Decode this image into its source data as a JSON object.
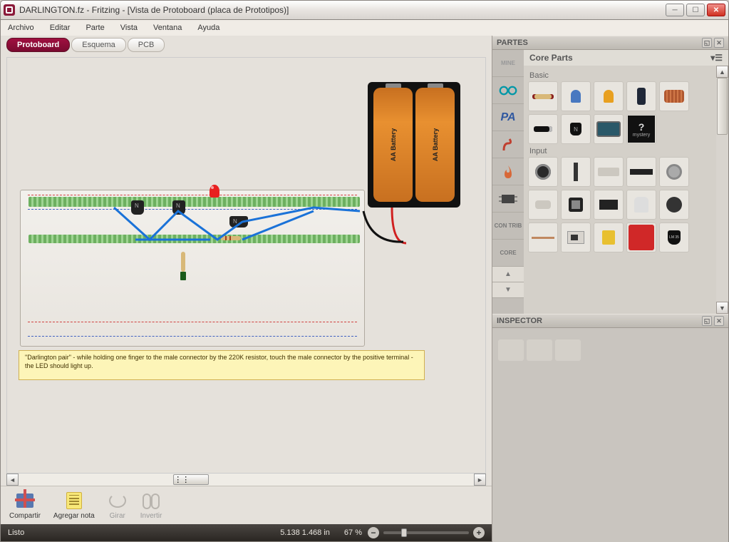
{
  "title": "DARLINGTON.fz - Fritzing - [Vista de Protoboard (placa de Prototipos)]",
  "menu": {
    "archivo": "Archivo",
    "editar": "Editar",
    "parte": "Parte",
    "vista": "Vista",
    "ventana": "Ventana",
    "ayuda": "Ayuda"
  },
  "tabs": {
    "proto": "Protoboard",
    "esquema": "Esquema",
    "pcb": "PCB"
  },
  "battery": {
    "cell": "AA Battery"
  },
  "note_text": "\"Darlington pair\" - while holding one finger to the male connector by the 220K resistor, touch the male connector by the positive terminal - the LED should light up.",
  "toolbar": {
    "compartir": "Compartir",
    "nota": "Agregar nota",
    "girar": "Girar",
    "invertir": "Invertir"
  },
  "status": {
    "ready": "Listo",
    "coords": "5.138 1.468 in",
    "zoom": "67 %"
  },
  "partes": {
    "panel": "PARTES",
    "title": "Core Parts",
    "bins": {
      "mine": "MINE",
      "pa": "PA",
      "contrib": "CON TRIB",
      "core": "CORE"
    },
    "groups": {
      "basic": "Basic",
      "input": "Input"
    },
    "mystery": "mystery",
    "lm": "LM 35"
  },
  "inspector": {
    "panel": "INSPECTOR"
  }
}
